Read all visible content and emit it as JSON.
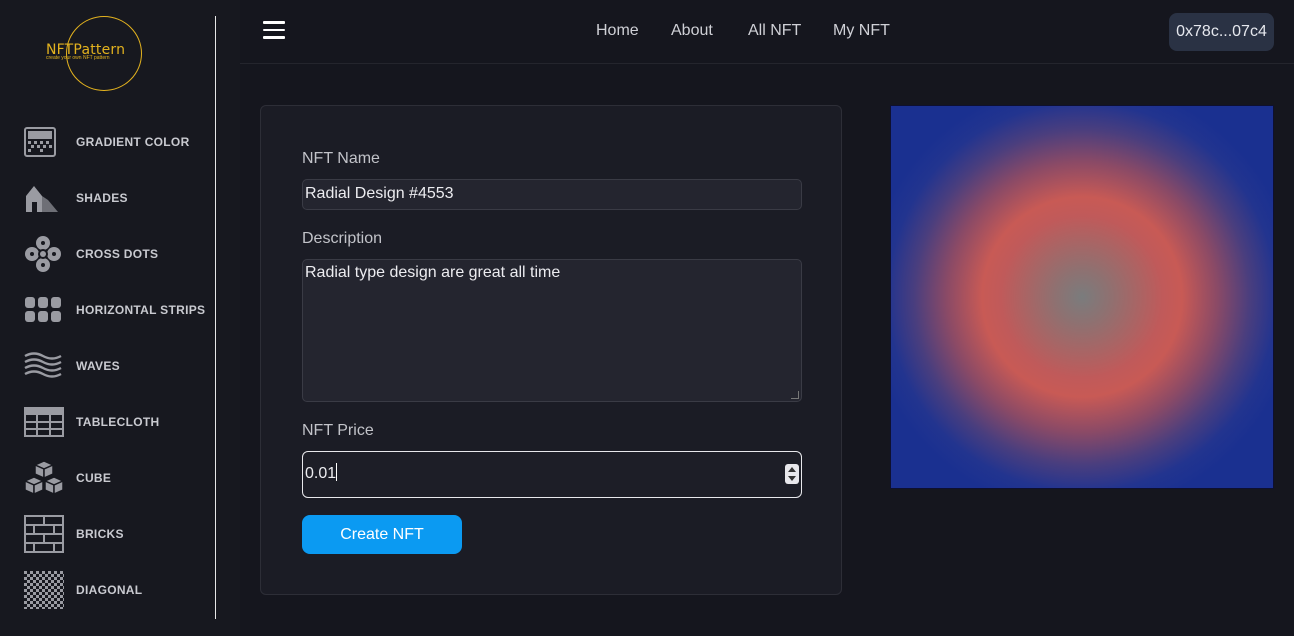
{
  "logo": {
    "title": "NFTPattern",
    "subtitle": "create your own NFT pattern"
  },
  "sidebar": {
    "items": [
      {
        "label": "GRADIENT COLOR",
        "icon": "gradient-icon"
      },
      {
        "label": "SHADES",
        "icon": "shades-icon"
      },
      {
        "label": "CROSS DOTS",
        "icon": "cross-dots-icon"
      },
      {
        "label": "HORIZONTAL STRIPS",
        "icon": "horizontal-strips-icon"
      },
      {
        "label": "WAVES",
        "icon": "waves-icon"
      },
      {
        "label": "TABLECLOTH",
        "icon": "tablecloth-icon"
      },
      {
        "label": "CUBE",
        "icon": "cube-icon"
      },
      {
        "label": "BRICKS",
        "icon": "bricks-icon"
      },
      {
        "label": "DIAGONAL",
        "icon": "diagonal-icon"
      }
    ]
  },
  "nav": {
    "links": [
      "Home",
      "About",
      "All NFT",
      "My NFT"
    ],
    "wallet": "0x78c...07c4"
  },
  "form": {
    "name_label": "NFT Name",
    "name_value": "Radial Design #4553",
    "description_label": "Description",
    "description_value": "Radial type design are great all time",
    "price_label": "NFT Price",
    "price_value": "0.01",
    "submit_label": "Create NFT"
  },
  "preview": {
    "type": "radial-gradient",
    "colors": [
      "#7a7c7d",
      "#c05a5a",
      "#1a3090"
    ]
  },
  "colors": {
    "accent": "#0b9af2",
    "logo": "#e3b21f",
    "background": "#15161e"
  }
}
